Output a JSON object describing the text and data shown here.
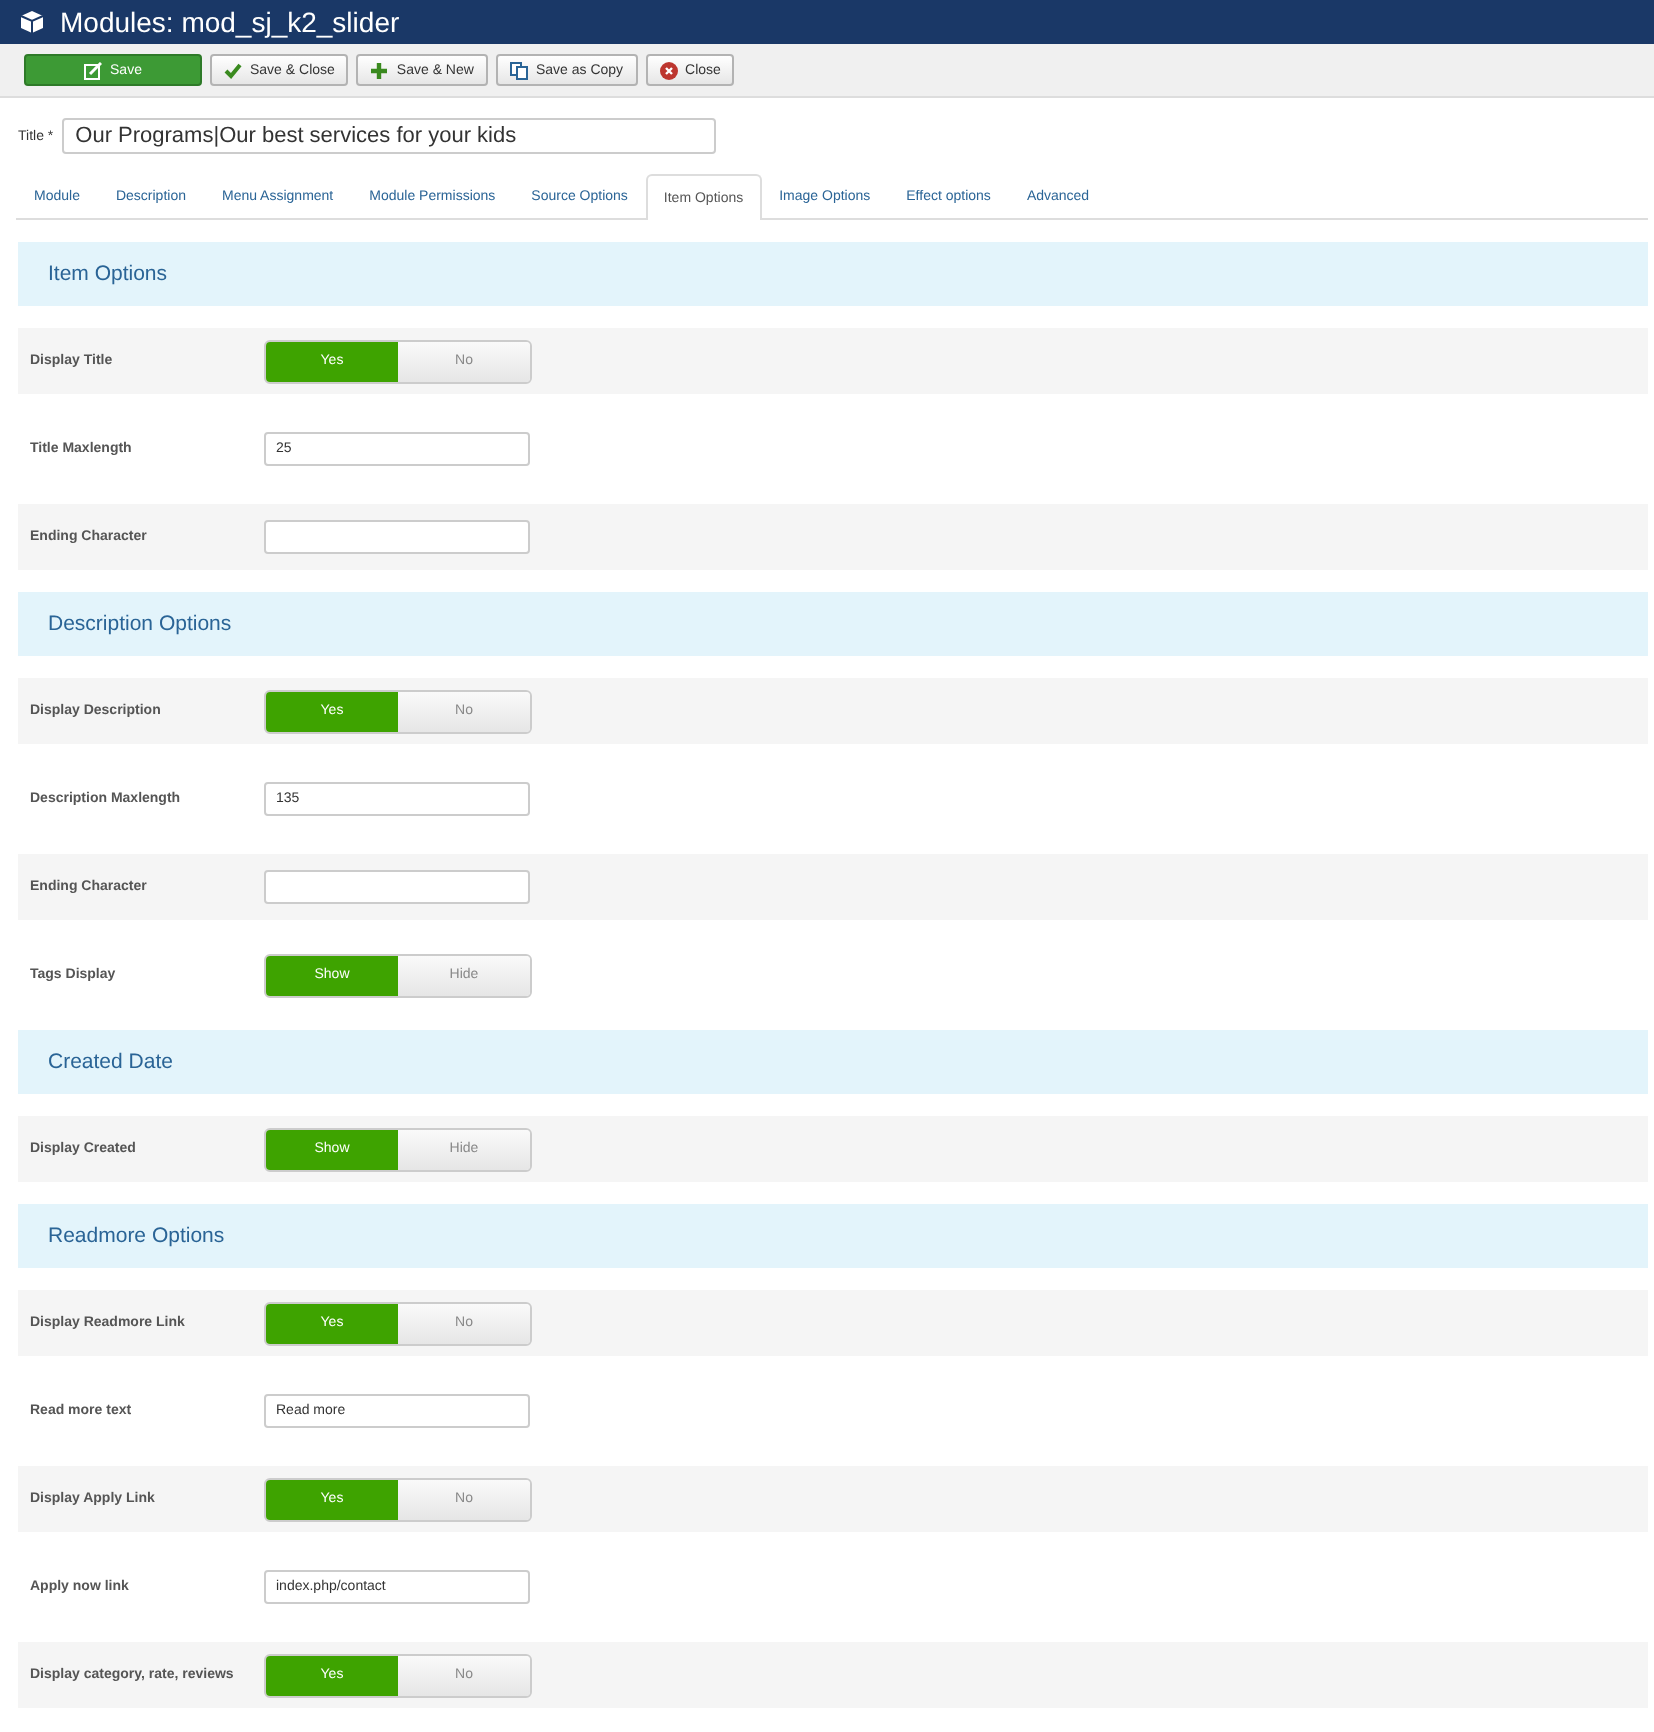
{
  "window": {
    "title": "Modules: mod_sj_k2_slider"
  },
  "toolbar": [
    {
      "label": "Save",
      "kind": "primary"
    },
    {
      "label": "Save & Close",
      "kind": "check"
    },
    {
      "label": "Save & New",
      "kind": "plus"
    },
    {
      "label": "Save as Copy",
      "kind": "copy"
    },
    {
      "label": "Close",
      "kind": "close"
    }
  ],
  "title_field": {
    "label": "Title *",
    "value": "Our Programs|Our best services for your kids"
  },
  "tabs": [
    {
      "label": "Module",
      "selected": false
    },
    {
      "label": "Description",
      "selected": false
    },
    {
      "label": "Menu Assignment",
      "selected": false
    },
    {
      "label": "Module Permissions",
      "selected": false
    },
    {
      "label": "Source Options",
      "selected": false
    },
    {
      "label": "Item Options",
      "selected": true
    },
    {
      "label": "Image Options",
      "selected": false
    },
    {
      "label": "Effect options",
      "selected": false
    },
    {
      "label": "Advanced",
      "selected": false
    }
  ],
  "sections": [
    {
      "title": "Item Options",
      "rows": [
        {
          "kind": "toggle",
          "label": "Display Title",
          "options": [
            {
              "label": "Yes",
              "selected": true
            },
            {
              "label": "No",
              "selected": false
            }
          ]
        },
        {
          "kind": "text",
          "label": "Title Maxlength",
          "value": "25"
        },
        {
          "kind": "text",
          "label": "Ending Character"
        }
      ]
    },
    {
      "title": "Description Options",
      "rows": [
        {
          "kind": "toggle",
          "label": "Display Description",
          "options": [
            {
              "label": "Yes",
              "selected": true
            },
            {
              "label": "No",
              "selected": false
            }
          ]
        },
        {
          "kind": "text",
          "label": "Description Maxlength",
          "value": "135"
        },
        {
          "kind": "text",
          "label": "Ending Character"
        },
        {
          "kind": "toggle",
          "label": "Tags Display",
          "options": [
            {
              "label": "Show",
              "selected": true
            },
            {
              "label": "Hide",
              "selected": false
            }
          ]
        }
      ]
    },
    {
      "title": "Created Date",
      "rows": [
        {
          "kind": "toggle",
          "label": "Display Created",
          "options": [
            {
              "label": "Show",
              "selected": true
            },
            {
              "label": "Hide",
              "selected": false
            }
          ]
        }
      ]
    },
    {
      "title": "Readmore Options",
      "rows": [
        {
          "kind": "toggle",
          "label": "Display Readmore Link",
          "options": [
            {
              "label": "Yes",
              "selected": true
            },
            {
              "label": "No",
              "selected": false
            }
          ]
        },
        {
          "kind": "text",
          "label": "Read more text",
          "value": "Read more"
        },
        {
          "kind": "toggle",
          "label": "Display Apply Link",
          "options": [
            {
              "label": "Yes",
              "selected": true
            },
            {
              "label": "No",
              "selected": false
            }
          ]
        },
        {
          "kind": "text",
          "label": "Apply now link",
          "value": "index.php/contact"
        },
        {
          "kind": "toggle",
          "label": "Display category, rate, reviews",
          "options": [
            {
              "label": "Yes",
              "selected": true
            },
            {
              "label": "No",
              "selected": false
            }
          ]
        }
      ]
    }
  ]
}
